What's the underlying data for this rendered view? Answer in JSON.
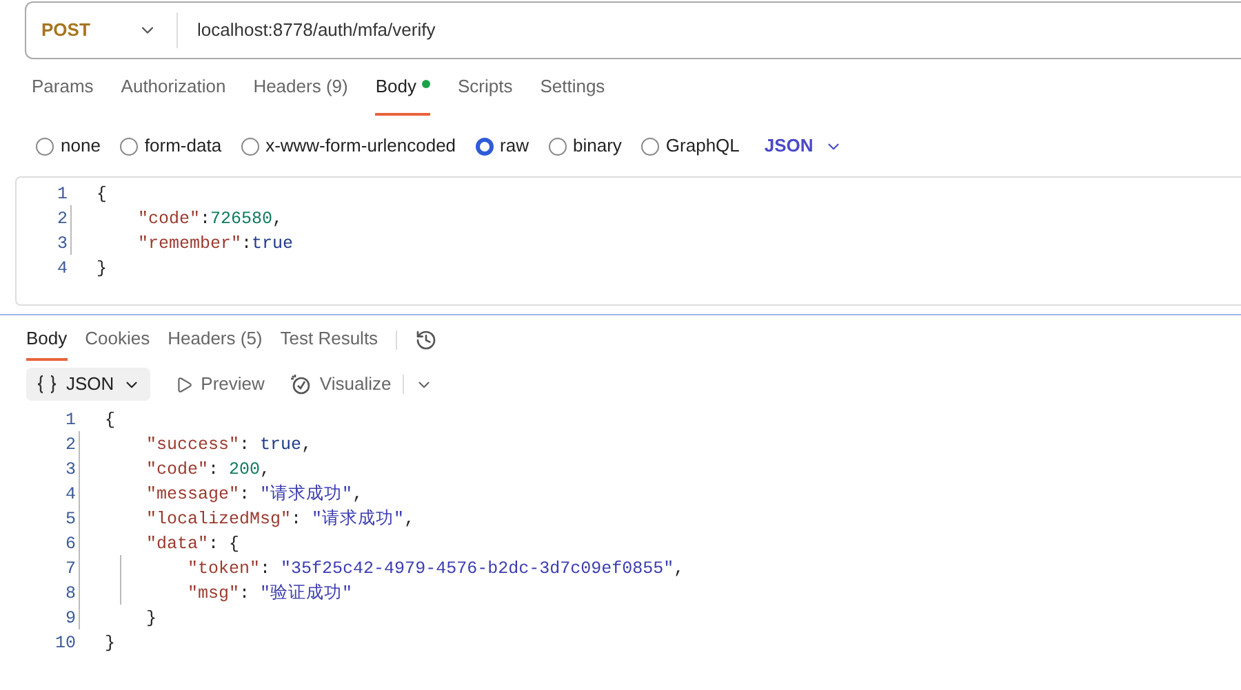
{
  "request": {
    "method": "POST",
    "url": "localhost:8778/auth/mfa/verify"
  },
  "request_tabs": [
    {
      "label": "Params",
      "selected": false,
      "dot": false
    },
    {
      "label": "Authorization",
      "selected": false,
      "dot": false
    },
    {
      "label": "Headers",
      "count": "(9)",
      "selected": false,
      "dot": false
    },
    {
      "label": "Body",
      "selected": true,
      "dot": true
    },
    {
      "label": "Scripts",
      "selected": false,
      "dot": false
    },
    {
      "label": "Settings",
      "selected": false,
      "dot": false
    }
  ],
  "body_types": [
    {
      "label": "none",
      "selected": false
    },
    {
      "label": "form-data",
      "selected": false
    },
    {
      "label": "x-www-form-urlencoded",
      "selected": false
    },
    {
      "label": "raw",
      "selected": true
    },
    {
      "label": "binary",
      "selected": false
    },
    {
      "label": "GraphQL",
      "selected": false
    }
  ],
  "body_format": "JSON",
  "request_body": [
    {
      "number": "1",
      "tokens": [
        {
          "kind": "punct",
          "text": "{"
        }
      ]
    },
    {
      "number": "2",
      "tokens": [
        {
          "kind": "key",
          "text": "    \"code\""
        },
        {
          "kind": "punct",
          "text": ":"
        },
        {
          "kind": "number",
          "text": "726580"
        },
        {
          "kind": "punct",
          "text": ","
        }
      ]
    },
    {
      "number": "3",
      "tokens": [
        {
          "kind": "key",
          "text": "    \"remember\""
        },
        {
          "kind": "punct",
          "text": ":"
        },
        {
          "kind": "bool",
          "text": "true"
        }
      ]
    },
    {
      "number": "4",
      "tokens": [
        {
          "kind": "punct",
          "text": "}"
        }
      ]
    }
  ],
  "response_tabs": [
    {
      "label": "Body",
      "selected": true
    },
    {
      "label": "Cookies",
      "selected": false
    },
    {
      "label": "Headers",
      "count": "(5)",
      "selected": false
    },
    {
      "label": "Test Results",
      "selected": false
    }
  ],
  "response_toolbar": {
    "format": "JSON",
    "preview": "Preview",
    "visualize": "Visualize"
  },
  "response_body": [
    {
      "number": "1",
      "tokens": [
        {
          "kind": "punct",
          "text": "{"
        }
      ]
    },
    {
      "number": "2",
      "tokens": [
        {
          "kind": "key",
          "text": "    \"success\""
        },
        {
          "kind": "punct",
          "text": ": "
        },
        {
          "kind": "bool",
          "text": "true"
        },
        {
          "kind": "punct",
          "text": ","
        }
      ]
    },
    {
      "number": "3",
      "tokens": [
        {
          "kind": "key",
          "text": "    \"code\""
        },
        {
          "kind": "punct",
          "text": ": "
        },
        {
          "kind": "number",
          "text": "200"
        },
        {
          "kind": "punct",
          "text": ","
        }
      ]
    },
    {
      "number": "4",
      "tokens": [
        {
          "kind": "key",
          "text": "    \"message\""
        },
        {
          "kind": "punct",
          "text": ": "
        },
        {
          "kind": "string",
          "text": "\"请求成功\""
        },
        {
          "kind": "punct",
          "text": ","
        }
      ]
    },
    {
      "number": "5",
      "tokens": [
        {
          "kind": "key",
          "text": "    \"localizedMsg\""
        },
        {
          "kind": "punct",
          "text": ": "
        },
        {
          "kind": "string",
          "text": "\"请求成功\""
        },
        {
          "kind": "punct",
          "text": ","
        }
      ]
    },
    {
      "number": "6",
      "tokens": [
        {
          "kind": "key",
          "text": "    \"data\""
        },
        {
          "kind": "punct",
          "text": ": {"
        }
      ]
    },
    {
      "number": "7",
      "tokens": [
        {
          "kind": "key",
          "text": "        \"token\""
        },
        {
          "kind": "punct",
          "text": ": "
        },
        {
          "kind": "string",
          "text": "\"35f25c42-4979-4576-b2dc-3d7c09ef0855\""
        },
        {
          "kind": "punct",
          "text": ","
        }
      ]
    },
    {
      "number": "8",
      "tokens": [
        {
          "kind": "key",
          "text": "        \"msg\""
        },
        {
          "kind": "punct",
          "text": ": "
        },
        {
          "kind": "string",
          "text": "\"验证成功\""
        }
      ]
    },
    {
      "number": "9",
      "tokens": [
        {
          "kind": "punct",
          "text": "    }"
        }
      ]
    },
    {
      "number": "10",
      "tokens": [
        {
          "kind": "punct",
          "text": "}"
        }
      ]
    }
  ]
}
